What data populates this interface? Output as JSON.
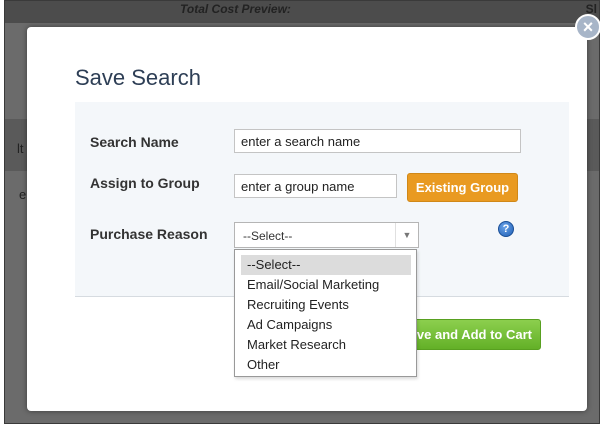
{
  "background": {
    "header_text": "Total Cost Preview:",
    "header_right": "Sl",
    "fragment_1": "lt",
    "fragment_2": "e"
  },
  "modal": {
    "title": "Save Search",
    "close_icon": "close-icon"
  },
  "form": {
    "search_name": {
      "label": "Search Name",
      "placeholder": "enter a search name"
    },
    "assign_group": {
      "label": "Assign to Group",
      "placeholder": "enter a group name",
      "existing_button": "Existing Group"
    },
    "purchase_reason": {
      "label": "Purchase Reason",
      "selected": "--Select--",
      "help_icon": "help-icon",
      "help_glyph": "?"
    }
  },
  "dropdown": {
    "options": [
      "--Select--",
      "Email/Social Marketing",
      "Recruiting Events",
      "Ad Campaigns",
      "Market Research",
      "Other"
    ],
    "selected_index": 0
  },
  "actions": {
    "save_add_cart": "ve and Add to Cart"
  },
  "colors": {
    "title": "#2d3e55",
    "existing_button": "#e99a21",
    "save_button": "#63b027",
    "help_icon": "#1e5fb5"
  }
}
